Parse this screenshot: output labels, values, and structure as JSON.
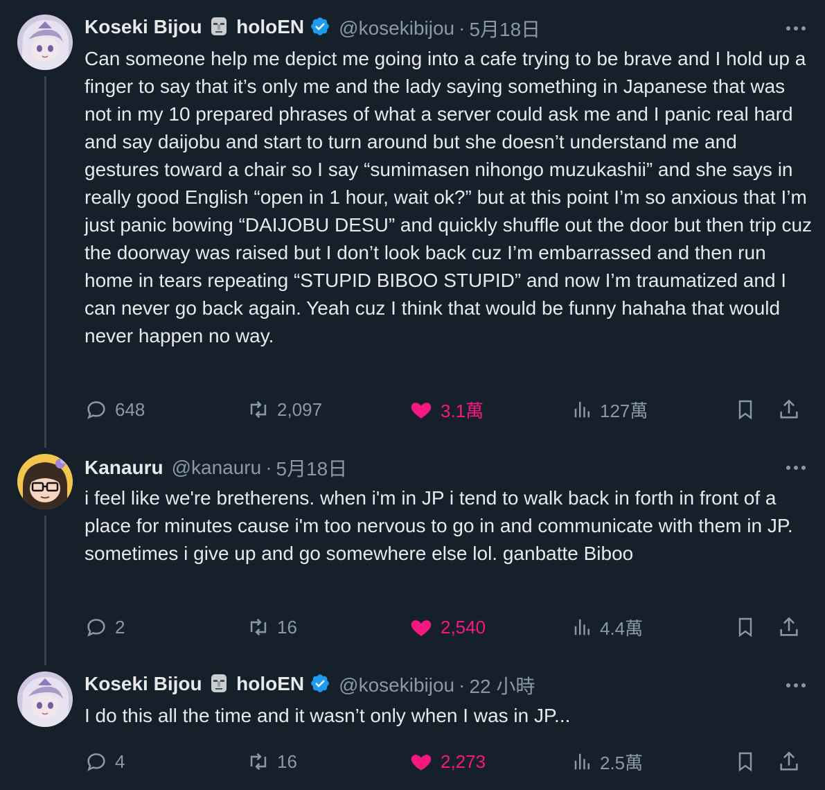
{
  "colors": {
    "background": "#15202b",
    "text": "#e7e9ea",
    "muted": "#8b98a5",
    "like": "#f91880",
    "verified": "#1d9bf0"
  },
  "tweets": [
    {
      "author": {
        "name": "Koseki Bijou",
        "name_suffix": "holoEN",
        "emoji": "moai",
        "verified": true,
        "handle": "@kosekibijou"
      },
      "separator": "·",
      "time": "5月18日",
      "text": "Can someone help me depict me going into a cafe trying to be brave and I hold up a finger to say that it’s only me and the lady saying something in Japanese that was not in my 10 prepared phrases of what a server could ask me and I panic real hard and say daijobu and start to turn around but she doesn’t understand me and gestures toward a chair so I say “sumimasen nihongo muzukashii” and she says in really good English “open in 1 hour, wait ok?” but at this point I’m so anxious that I’m just panic bowing “DAIJOBU DESU” and quickly shuffle out the door but then trip cuz the doorway was raised but I don’t look back cuz I’m embarrassed and then run home in tears repeating “STUPID BIBOO STUPID” and now I’m traumatized and I can never go back again. Yeah cuz I think that would be funny hahaha that would never happen no way.",
      "stats": {
        "replies": "648",
        "retweets": "2,097",
        "likes": "3.1萬",
        "views": "127萬"
      }
    },
    {
      "author": {
        "name": "Kanauru",
        "handle": "@kanauru"
      },
      "separator": "·",
      "time": "5月18日",
      "text": "i feel like we're bretherens. when i'm in JP i tend to walk back in forth in front of a place for minutes cause i'm too nervous to go in and communicate with them in JP. sometimes i give up and go somewhere else lol. ganbatte Biboo",
      "stats": {
        "replies": "2",
        "retweets": "16",
        "likes": "2,540",
        "views": "4.4萬"
      }
    },
    {
      "author": {
        "name": "Koseki Bijou",
        "name_suffix": "holoEN",
        "emoji": "moai",
        "verified": true,
        "handle": "@kosekibijou"
      },
      "separator": "·",
      "time": "22 小時",
      "text": "I do this all the time and it wasn’t only when I was in JP...",
      "stats": {
        "replies": "4",
        "retweets": "16",
        "likes": "2,273",
        "views": "2.5萬"
      }
    }
  ],
  "icons": {
    "more": "more-horizontal-icon",
    "reply": "reply-icon",
    "retweet": "retweet-icon",
    "like": "heart-icon",
    "views": "views-icon",
    "bookmark": "bookmark-icon",
    "share": "share-icon"
  }
}
